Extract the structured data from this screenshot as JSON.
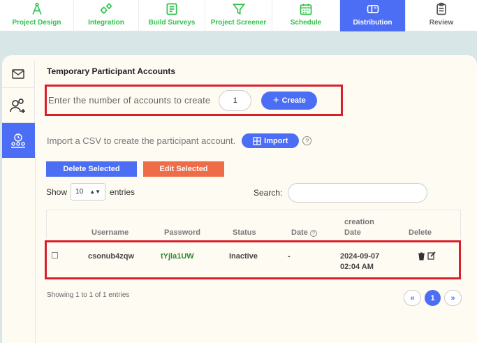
{
  "nav": {
    "tabs": [
      {
        "label": "Project Design",
        "icon": "compass-icon"
      },
      {
        "label": "Integration",
        "icon": "gears-icon"
      },
      {
        "label": "Build Surveys",
        "icon": "survey-icon"
      },
      {
        "label": "Project Screener",
        "icon": "filter-icon"
      },
      {
        "label": "Schedule",
        "icon": "calendar-icon"
      },
      {
        "label": "Distribution",
        "icon": "mailbox-icon",
        "active": true
      },
      {
        "label": "Review",
        "icon": "clipboard-icon"
      }
    ]
  },
  "sidebar": {
    "items": [
      {
        "icon": "mail-icon"
      },
      {
        "icon": "add-users-icon"
      },
      {
        "icon": "group-clock-icon",
        "active": true
      }
    ]
  },
  "page": {
    "title": "Temporary Participant Accounts",
    "create_label": "Enter the number of accounts to create",
    "create_count": "1",
    "create_button": "Create",
    "import_label": "Import a CSV to create the participant account.",
    "import_button": "Import",
    "help": "?",
    "delete_selected": "Delete Selected",
    "edit_selected": "Edit Selected",
    "show_label": "Show",
    "show_value": "10",
    "entries_label": "entries",
    "search_label": "Search:"
  },
  "table": {
    "columns": {
      "username": "Username",
      "password": "Password",
      "status": "Status",
      "date": "Date",
      "creation_date_line1": "creation",
      "creation_date_line2": "Date",
      "delete": "Delete"
    },
    "rows": [
      {
        "username": "csonub4zqw",
        "password": "tYjla1UW",
        "status": "Inactive",
        "date": "-",
        "created_date": "2024-09-07",
        "created_time": "02:04 AM"
      }
    ]
  },
  "footer": {
    "showing": "Showing 1 to 1 of 1 entries",
    "prev": "«",
    "page": "1",
    "next": "»"
  },
  "colors": {
    "accent": "#4c6ef5",
    "nav_green": "#2ec24a",
    "edit_orange": "#ee6c47",
    "highlight_red": "#d91f2b"
  }
}
